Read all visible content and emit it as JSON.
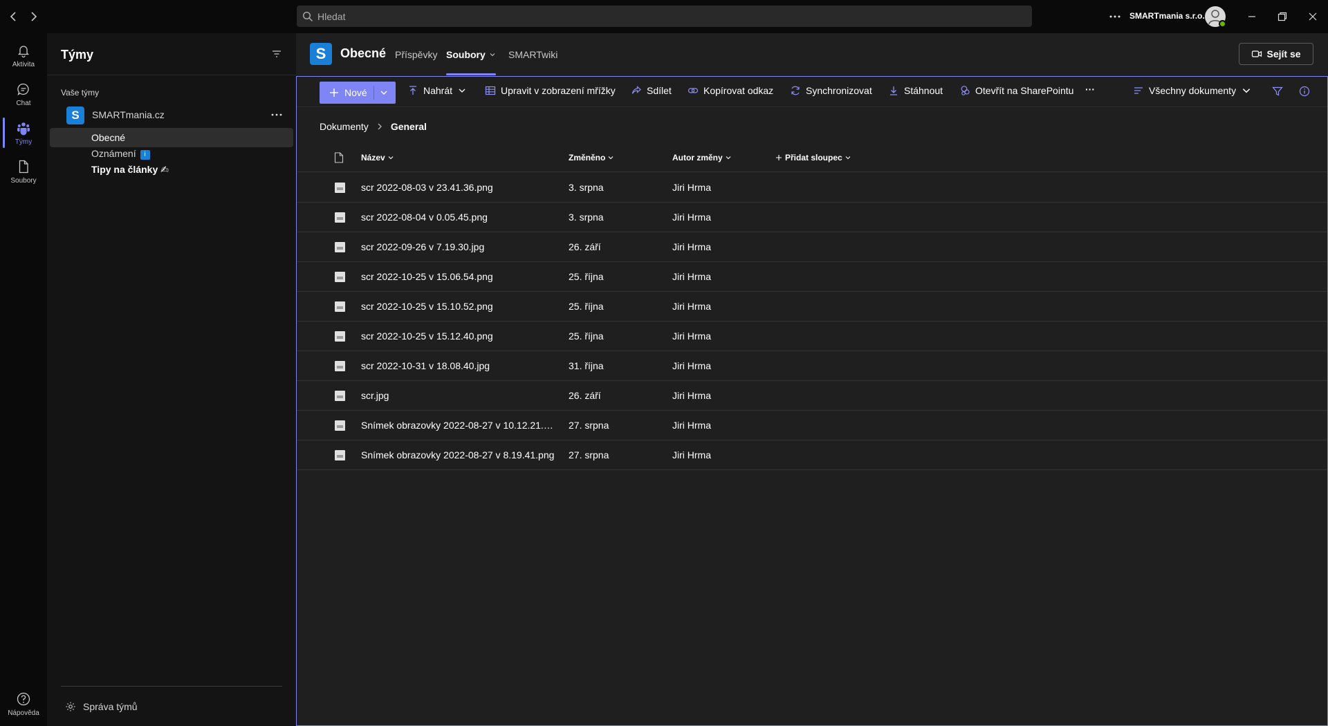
{
  "colors": {
    "accent": "#7f85f5",
    "team_logo": "#1a7fd6",
    "presence": "#6bb700"
  },
  "titlebar": {
    "search_placeholder": "Hledat",
    "org_name": "SMARTmania s.r.o."
  },
  "rail": {
    "items": [
      {
        "label": "Aktivita",
        "icon": "bell-icon"
      },
      {
        "label": "Chat",
        "icon": "chat-icon"
      },
      {
        "label": "Týmy",
        "icon": "teams-icon",
        "active": true
      },
      {
        "label": "Soubory",
        "icon": "file-icon"
      }
    ],
    "help_label": "Nápověda"
  },
  "teams_panel": {
    "title": "Týmy",
    "section_label": "Vaše týmy",
    "team": {
      "logo_letter": "S",
      "name": "SMARTmania.cz"
    },
    "channels": [
      {
        "label": "Obecné",
        "selected": true
      },
      {
        "label": "Oznámení",
        "badge": "i"
      },
      {
        "label": "Tipy na články ✍",
        "bold": true
      }
    ],
    "manage_label": "Správa týmů"
  },
  "channel_header": {
    "logo_letter": "S",
    "name": "Obecné",
    "tabs": [
      {
        "label": "Příspěvky"
      },
      {
        "label": "Soubory",
        "active": true
      },
      {
        "label": "SMARTwiki"
      }
    ],
    "meet_label": "Sejít se"
  },
  "commands": {
    "new": "Nové",
    "upload": "Nahrát",
    "grid_edit": "Upravit v zobrazení mřížky",
    "share": "Sdílet",
    "copy_link": "Kopírovat odkaz",
    "sync": "Synchronizovat",
    "download": "Stáhnout",
    "open_sharepoint": "Otevřít na SharePointu",
    "more": "···",
    "view": "Všechny dokumenty"
  },
  "breadcrumb": {
    "root": "Dokumenty",
    "current": "General"
  },
  "columns": {
    "name": "Název",
    "modified": "Změněno",
    "modified_by": "Autor změny",
    "add_column": "Přidat sloupec"
  },
  "files": [
    {
      "name": "scr 2022-08-03 v 23.41.36.png",
      "modified": "3. srpna",
      "author": "Jiri Hrma"
    },
    {
      "name": "scr 2022-08-04 v 0.05.45.png",
      "modified": "3. srpna",
      "author": "Jiri Hrma"
    },
    {
      "name": "scr 2022-09-26 v 7.19.30.jpg",
      "modified": "26. září",
      "author": "Jiri Hrma"
    },
    {
      "name": "scr 2022-10-25 v 15.06.54.png",
      "modified": "25. října",
      "author": "Jiri Hrma"
    },
    {
      "name": "scr 2022-10-25 v 15.10.52.png",
      "modified": "25. října",
      "author": "Jiri Hrma"
    },
    {
      "name": "scr 2022-10-25 v 15.12.40.png",
      "modified": "25. října",
      "author": "Jiri Hrma"
    },
    {
      "name": "scr 2022-10-31 v 18.08.40.jpg",
      "modified": "31. října",
      "author": "Jiri Hrma"
    },
    {
      "name": "scr.jpg",
      "modified": "26. září",
      "author": "Jiri Hrma"
    },
    {
      "name": "Snímek obrazovky 2022-08-27 v 10.12.21.p...",
      "modified": "27. srpna",
      "author": "Jiri Hrma"
    },
    {
      "name": "Snímek obrazovky 2022-08-27 v 8.19.41.png",
      "modified": "27. srpna",
      "author": "Jiri Hrma"
    }
  ]
}
